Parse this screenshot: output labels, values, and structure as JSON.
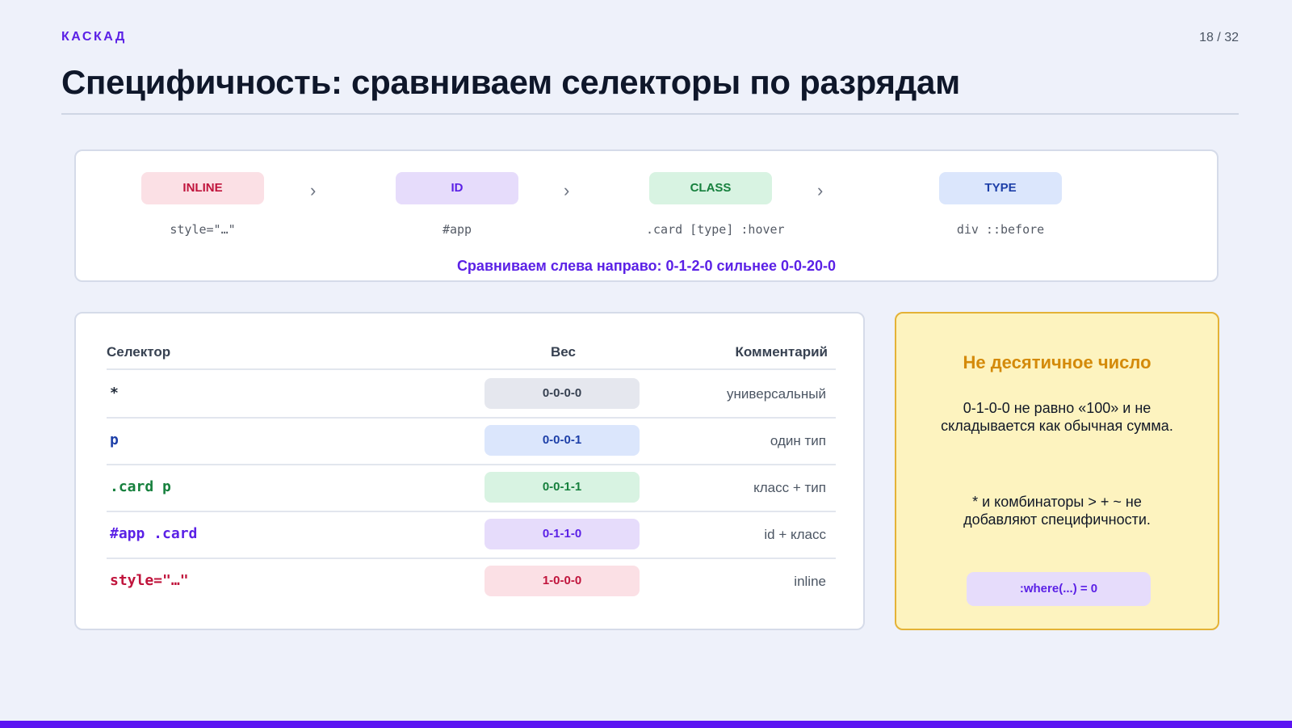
{
  "header": {
    "kicker": "КАСКАД",
    "page": "18 / 32",
    "title": "Специфичность: сравниваем селекторы по разрядам"
  },
  "ranks": {
    "items": [
      {
        "label": "INLINE",
        "example": "style=\"…\"",
        "bg": "#fbe0e5",
        "fg": "#c0143c"
      },
      {
        "label": "ID",
        "example": "#app",
        "bg": "#e6dcfb",
        "fg": "#5b21e6"
      },
      {
        "label": "CLASS",
        "example": ".card [type] :hover",
        "bg": "#d8f3e2",
        "fg": "#16803d"
      },
      {
        "label": "TYPE",
        "example": "div ::before",
        "bg": "#dbe6fc",
        "fg": "#1d3fa8"
      }
    ],
    "arrow": "›",
    "note": "Сравниваем слева направо: 0-1-2-0 сильнее 0-0-20-0"
  },
  "table": {
    "headers": {
      "selector": "Селектор",
      "weight": "Вес",
      "comment": "Комментарий"
    },
    "rows": [
      {
        "selector": "*",
        "weight": "0-0-0-0",
        "comment": "универсальный",
        "sel_color": "#1f2937",
        "wt_bg": "#e5e7ee",
        "wt_fg": "#374151"
      },
      {
        "selector": "p",
        "weight": "0-0-0-1",
        "comment": "один тип",
        "sel_color": "#1d3fa8",
        "wt_bg": "#dbe6fc",
        "wt_fg": "#1d3fa8"
      },
      {
        "selector": ".card p",
        "weight": "0-0-1-1",
        "comment": "класс + тип",
        "sel_color": "#16803d",
        "wt_bg": "#d8f3e2",
        "wt_fg": "#16803d"
      },
      {
        "selector": "#app .card",
        "weight": "0-1-1-0",
        "comment": "id + класс",
        "sel_color": "#5b21e6",
        "wt_bg": "#e6dcfb",
        "wt_fg": "#5b21e6"
      },
      {
        "selector": "style=\"…\"",
        "weight": "1-0-0-0",
        "comment": "inline",
        "sel_color": "#c0143c",
        "wt_bg": "#fbe0e5",
        "wt_fg": "#c0143c"
      }
    ]
  },
  "note": {
    "title": "Не десятичное число",
    "p1": "0-1-0-0 не равно «100» и не складывается как обычная сумма.",
    "p2": "* и комбинаторы > + ~ не добавляют специфичности.",
    "pill": ":where(...) = 0"
  },
  "colors": {
    "accent": "#5b21e6",
    "bottom_bar": "#5b14f2",
    "note_title": "#d48a0a"
  }
}
